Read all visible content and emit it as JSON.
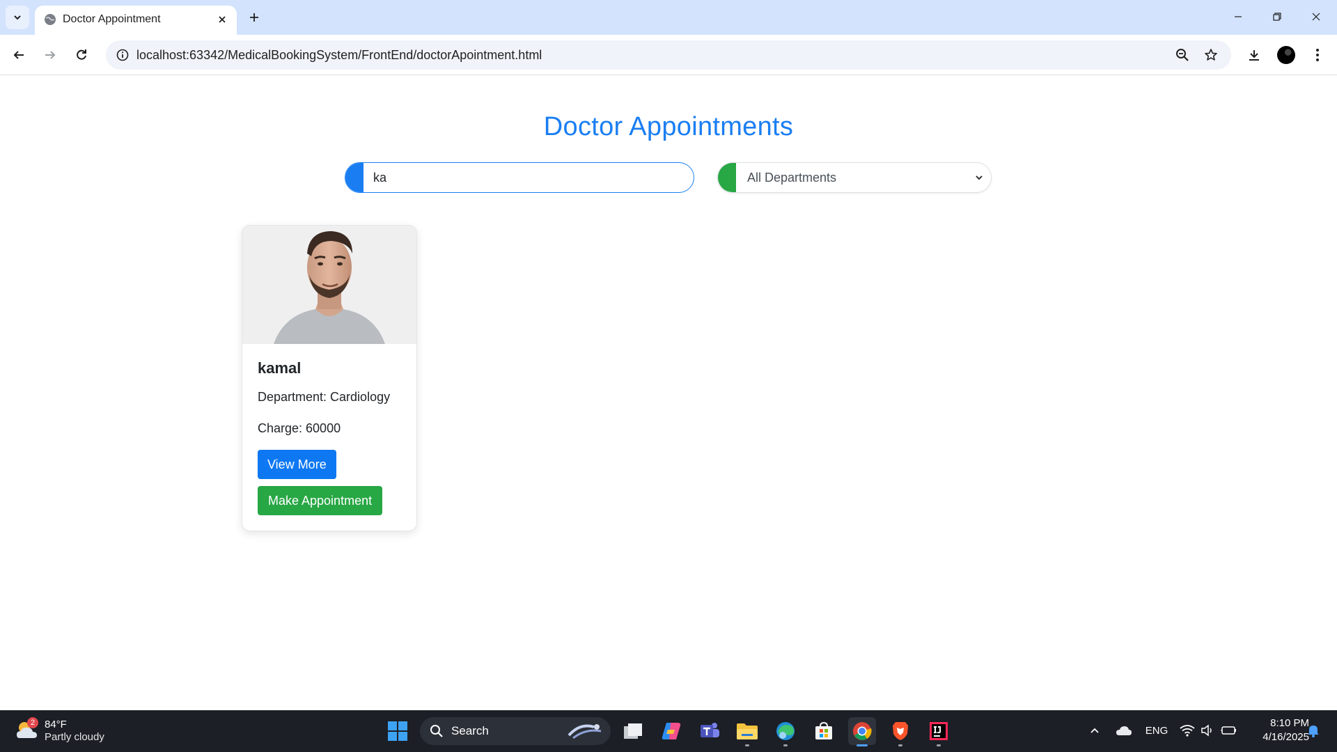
{
  "browser": {
    "tab_title": "Doctor Appointment",
    "url": "localhost:63342/MedicalBookingSystem/FrontEnd/doctorApointment.html"
  },
  "page": {
    "title": "Doctor Appointments",
    "search": {
      "value": "ka",
      "placeholder": ""
    },
    "department_filter": {
      "selected": "All Departments"
    }
  },
  "doctors": [
    {
      "name": "kamal",
      "department_line": "Department: Cardiology",
      "charge_line": "Charge: 60000",
      "view_more_label": "View More",
      "make_appointment_label": "Make Appointment"
    }
  ],
  "colors": {
    "accent_blue": "#1a7ef2",
    "accent_green": "#28a745"
  },
  "taskbar": {
    "weather": {
      "temp": "84°F",
      "desc": "Partly cloudy",
      "badge": "2"
    },
    "search_label": "Search",
    "language": "ENG",
    "time": "8:10 PM",
    "date": "4/16/2025"
  }
}
